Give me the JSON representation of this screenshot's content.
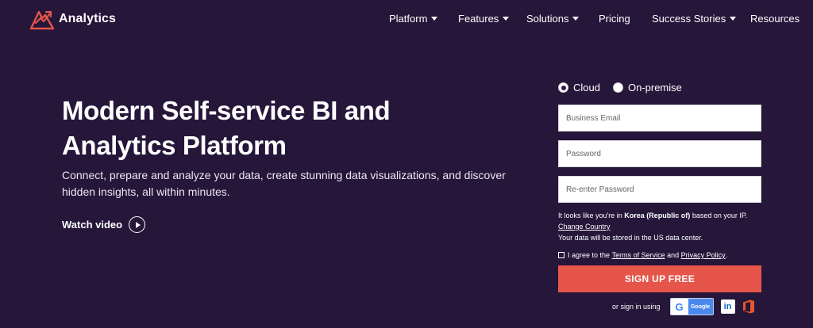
{
  "brand": {
    "name": "Analytics",
    "accent": "#e5554a"
  },
  "nav": [
    {
      "label": "Platform",
      "dropdown": true
    },
    {
      "label": "Features",
      "dropdown": true
    },
    {
      "label": "Solutions",
      "dropdown": true
    },
    {
      "label": "Pricing",
      "dropdown": false
    },
    {
      "label": "Success Stories",
      "dropdown": true
    },
    {
      "label": "Resources",
      "dropdown": false
    }
  ],
  "hero": {
    "title_line1": "Modern Self-service BI and",
    "title_line2": "Analytics Platform",
    "description": "Connect, prepare and analyze your data, create stunning data visualizations, and discover hidden insights, all within minutes.",
    "watch_label": "Watch video"
  },
  "form": {
    "deployment_options": [
      {
        "label": "Cloud",
        "selected": true
      },
      {
        "label": "On-premise",
        "selected": false
      }
    ],
    "email_placeholder": "Business Email",
    "password_placeholder": "Password",
    "reenter_placeholder": "Re-enter Password",
    "location_prefix": "It looks like you're in",
    "location_country": "Korea (Republic of)",
    "location_suffix": "based on your IP.",
    "change_country": "Change Country",
    "datacenter_note": "Your data will be stored in the US data center.",
    "agree_prefix": "I agree to the",
    "terms": "Terms of Service",
    "and": "and",
    "privacy": "Privacy Policy",
    "period": ".",
    "signup_label": "SIGN UP FREE",
    "alt_signin": "or sign in using",
    "google_label": "Google",
    "google_icon": "G",
    "linkedin_icon": "in"
  }
}
